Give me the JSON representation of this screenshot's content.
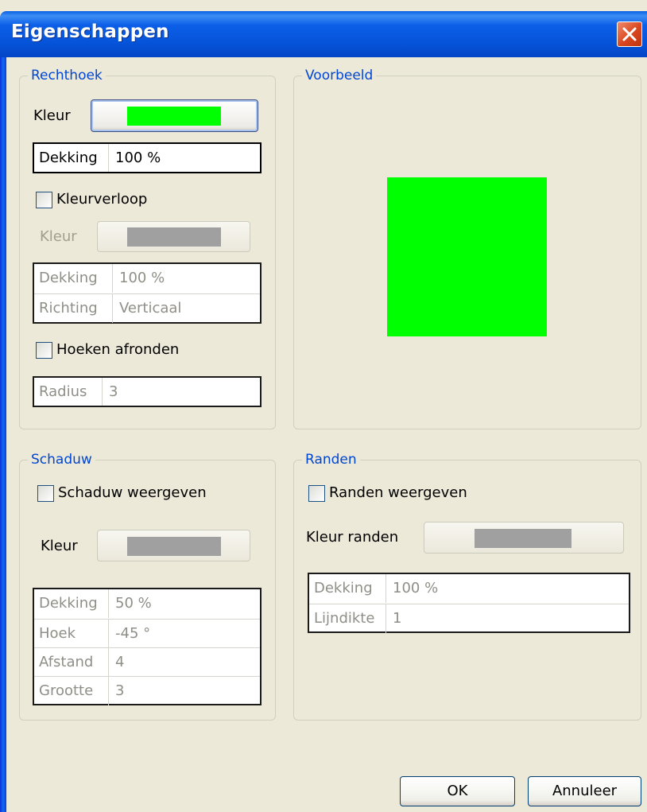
{
  "window": {
    "title": "Eigenschappen"
  },
  "rechthoek": {
    "legend": "Rechthoek",
    "kleur_label": "Kleur",
    "kleur_color": "#00ff00",
    "dekking_key": "Dekking",
    "dekking_value": "100 %",
    "kleurverloop_label": "Kleurverloop",
    "kleurverloop_checked": false,
    "gradient_kleur_label": "Kleur",
    "gradient_color": "#a0a0a0",
    "gradient_rows": [
      {
        "key": "Dekking",
        "value": "100 %"
      },
      {
        "key": "Richting",
        "value": "Verticaal"
      }
    ],
    "hoeken_label": "Hoeken afronden",
    "hoeken_checked": false,
    "radius_key": "Radius",
    "radius_value": "3"
  },
  "voorbeeld": {
    "legend": "Voorbeeld",
    "preview_color": "#00ff00"
  },
  "schaduw": {
    "legend": "Schaduw",
    "weergeven_label": "Schaduw weergeven",
    "weergeven_checked": false,
    "kleur_label": "Kleur",
    "kleur_color": "#a0a0a0",
    "rows": [
      {
        "key": "Dekking",
        "value": "50 %"
      },
      {
        "key": "Hoek",
        "value": "-45 °"
      },
      {
        "key": "Afstand",
        "value": "4"
      },
      {
        "key": "Grootte",
        "value": "3"
      }
    ]
  },
  "randen": {
    "legend": "Randen",
    "weergeven_label": "Randen weergeven",
    "weergeven_checked": false,
    "kleur_label": "Kleur randen",
    "kleur_color": "#a0a0a0",
    "rows": [
      {
        "key": "Dekking",
        "value": "100 %"
      },
      {
        "key": "Lijndikte",
        "value": "1"
      }
    ]
  },
  "footer": {
    "ok_label": "OK",
    "cancel_label": "Annuleer"
  },
  "colors": {
    "title_bar": "#0553d8",
    "legend": "#0046d5",
    "dialog_bg": "#ece9d8"
  }
}
